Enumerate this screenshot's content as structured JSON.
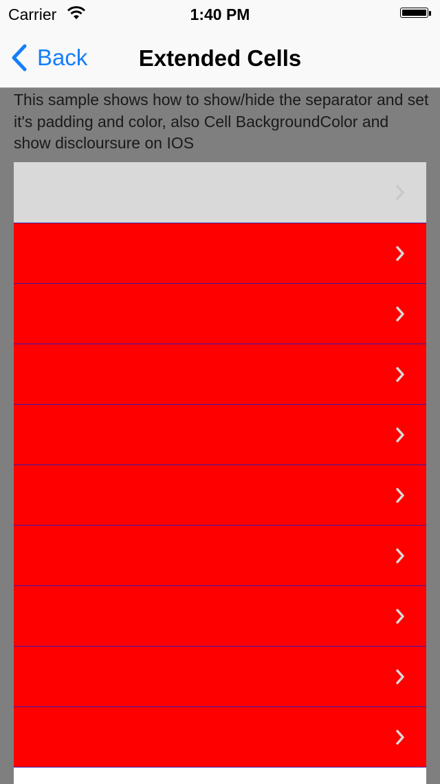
{
  "status_bar": {
    "carrier": "Carrier",
    "time": "1:40 PM",
    "wifi_icon": "wifi-icon",
    "battery_icon": "battery-icon",
    "battery_level": 1.0
  },
  "nav": {
    "back_label": "Back",
    "title": "Extended Cells",
    "back_icon": "chevron-left-icon",
    "accent_color": "#157efb"
  },
  "description": "This sample shows how to show/hide the separator and set it's padding and color, also Cell BackgroundColor and show discloursure on IOS",
  "list": {
    "separator_color": "#3a1aa8",
    "disclosure_icon": "chevron-right-icon",
    "cells": [
      {
        "background": "#d9d9d9",
        "selected": true
      },
      {
        "background": "#ff0000"
      },
      {
        "background": "#ff0000"
      },
      {
        "background": "#ff0000"
      },
      {
        "background": "#ff0000"
      },
      {
        "background": "#ff0000"
      },
      {
        "background": "#ff0000"
      },
      {
        "background": "#ff0000"
      },
      {
        "background": "#ff0000"
      },
      {
        "background": "#ff0000"
      }
    ]
  }
}
